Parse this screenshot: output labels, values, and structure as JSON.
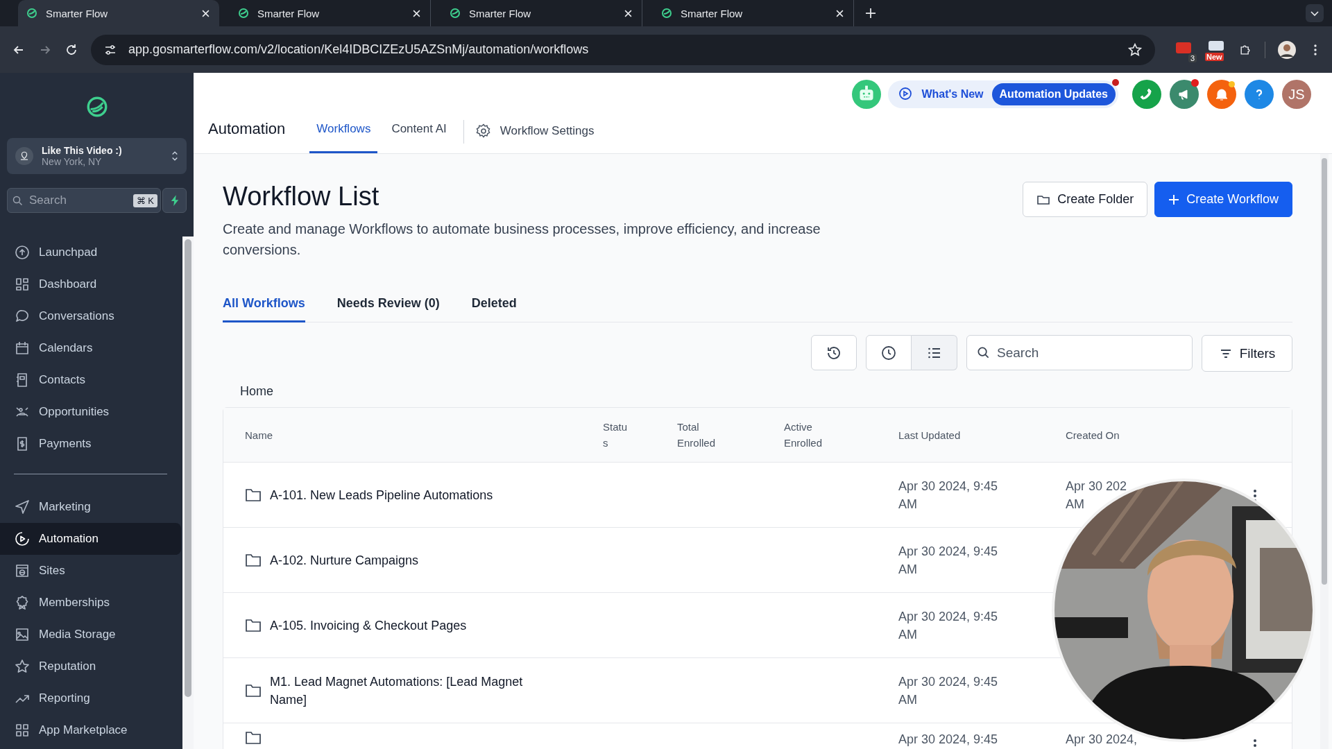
{
  "browser": {
    "tabs": [
      {
        "title": "Smarter Flow",
        "selected": true
      },
      {
        "title": "Smarter Flow",
        "selected": false
      },
      {
        "title": "Smarter Flow",
        "selected": false
      },
      {
        "title": "Smarter Flow",
        "selected": false
      }
    ],
    "url": "app.gosmarterflow.com/v2/location/Kel4IDBCIZEzU5AZSnMj/automation/workflows",
    "extension_count": "3",
    "extension_new": "New"
  },
  "sidebar": {
    "location": {
      "name": "Like This Video :)",
      "city": "New York, NY"
    },
    "search": {
      "placeholder": "Search",
      "shortcut": "⌘ K"
    },
    "items": [
      {
        "label": "Launchpad",
        "selected": false
      },
      {
        "label": "Dashboard",
        "selected": false
      },
      {
        "label": "Conversations",
        "selected": false
      },
      {
        "label": "Calendars",
        "selected": false
      },
      {
        "label": "Contacts",
        "selected": false
      },
      {
        "label": "Opportunities",
        "selected": false
      },
      {
        "label": "Payments",
        "selected": false
      }
    ],
    "items_more": [
      {
        "label": "Marketing",
        "selected": false
      },
      {
        "label": "Automation",
        "selected": true
      },
      {
        "label": "Sites",
        "selected": false
      },
      {
        "label": "Memberships",
        "selected": false
      },
      {
        "label": "Media Storage",
        "selected": false
      },
      {
        "label": "Reputation",
        "selected": false
      },
      {
        "label": "Reporting",
        "selected": false
      },
      {
        "label": "App Marketplace",
        "selected": false
      }
    ]
  },
  "header": {
    "title": "Automation",
    "tabs": [
      {
        "label": "Workflows",
        "selected": true
      },
      {
        "label": "Content AI",
        "selected": false
      }
    ],
    "settings": "Workflow Settings",
    "whats_new": "What's New",
    "updates": "Automation Updates",
    "avatar": "JS",
    "icon_buttons": [
      {
        "kind": "phone",
        "dot": false
      },
      {
        "kind": "megaphone",
        "dot": true
      },
      {
        "kind": "bell",
        "dot": true
      },
      {
        "kind": "help",
        "dot": false
      }
    ]
  },
  "page": {
    "title": "Workflow List",
    "description": "Create and manage Workflows to automate business processes, improve efficiency, and increase conversions.",
    "buttons": [
      {
        "label": "Create Folder",
        "kind": "secondary"
      },
      {
        "label": "Create Workflow",
        "kind": "primary"
      }
    ],
    "tabs": [
      {
        "label": "All Workflows",
        "selected": true
      },
      {
        "label": "Needs Review (0)",
        "selected": false
      },
      {
        "label": "Deleted",
        "selected": false
      }
    ],
    "search": {
      "placeholder": "Search"
    },
    "filters": "Filters",
    "breadcrumb": "Home"
  },
  "table": {
    "columns": [
      "Name",
      "Status",
      "Total Enrolled",
      "Active Enrolled",
      "Last Updated",
      "Created On"
    ],
    "rows": [
      {
        "name": "A-101. New Leads Pipeline Automations",
        "last_updated": "Apr 30 2024, 9:45 AM",
        "created_on": [
          "Apr 30 202",
          "AM"
        ]
      },
      {
        "name": "A-102. Nurture Campaigns",
        "last_updated": "Apr 30 2024, 9:45 AM"
      },
      {
        "name": "A-105. Invoicing & Checkout Pages",
        "last_updated": "Apr 30 2024, 9:45 AM"
      },
      {
        "name": "M1. Lead Magnet Automations: [Lead Magnet Name]",
        "last_updated": "Apr 30 2024, 9:45 AM"
      },
      {
        "last_updated": "Apr 30 2024, 9:45",
        "created_on": [
          "Apr 30 2024,"
        ]
      }
    ]
  }
}
